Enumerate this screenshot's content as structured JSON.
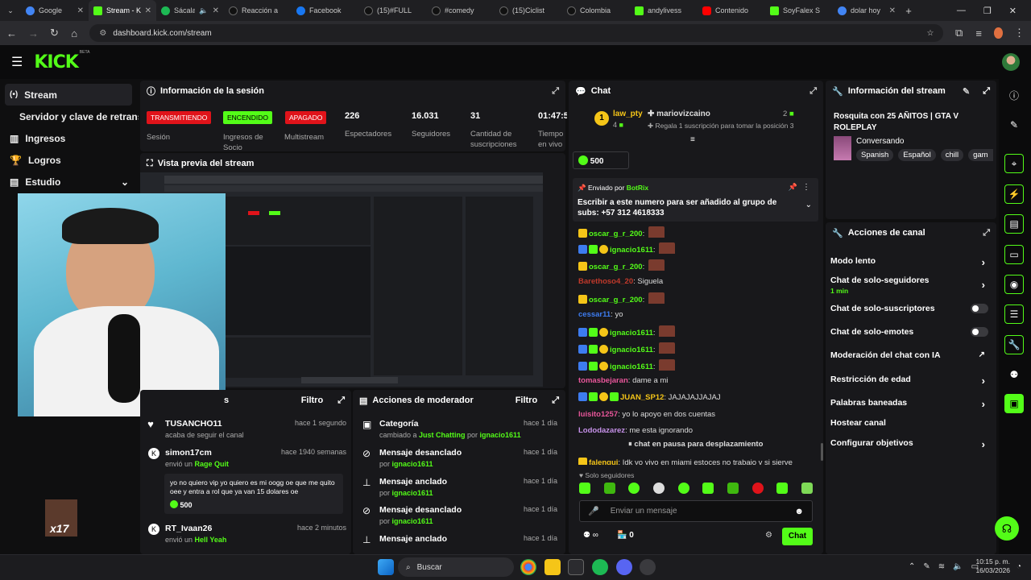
{
  "browser": {
    "tabs": [
      {
        "label": "Google",
        "color": "#4285f4"
      },
      {
        "label": "Stream - K",
        "color": "#53fc18"
      },
      {
        "label": "Sácala",
        "color": "#1db954"
      },
      {
        "label": "Reacción a",
        "color": "#111111"
      },
      {
        "label": "Facebook",
        "color": "#1877f2"
      },
      {
        "label": "(15)#FULL",
        "color": "#111111"
      },
      {
        "label": "#comedy",
        "color": "#111111"
      },
      {
        "label": "(15)Ciclist",
        "color": "#111111"
      },
      {
        "label": "Colombia",
        "color": "#111111"
      },
      {
        "label": "andylivess",
        "color": "#53fc18"
      },
      {
        "label": "Contenido",
        "color": "#ff0000"
      },
      {
        "label": "SoyFalex S",
        "color": "#53fc18"
      },
      {
        "label": "dolar hoy",
        "color": "#4285f4"
      }
    ],
    "url": "dashboard.kick.com/stream"
  },
  "sidebar": {
    "items": [
      {
        "label": "Stream",
        "icon": "stream-icon"
      },
      {
        "label": "Servidor y clave de retransm",
        "icon": ""
      },
      {
        "label": "Ingresos",
        "icon": "revenue-icon"
      },
      {
        "label": "Logros",
        "icon": "trophy-icon"
      },
      {
        "label": "Estudio",
        "icon": "studio-icon"
      }
    ]
  },
  "session": {
    "title": "Información de la sesión",
    "badges": [
      {
        "label": "TRANSMITIENDO",
        "color": "#e0131a",
        "caption": "Sesión"
      },
      {
        "label": "ENCENDIDO",
        "color": "#53fc18",
        "caption": "Ingresos de Socio"
      },
      {
        "label": "APAGADO",
        "color": "#e0131a",
        "caption": "Multistream"
      }
    ],
    "stats": [
      {
        "value": "226",
        "label": "Espectadores"
      },
      {
        "value": "16.031",
        "label": "Seguidores"
      },
      {
        "value": "31",
        "label": "Cantidad de suscripciones"
      },
      {
        "value": "01:47:5",
        "label": "Tiempo en vivo"
      }
    ]
  },
  "preview": {
    "title": "Vista previa del stream"
  },
  "activity": {
    "title_partial": "s",
    "filter": "Filtro",
    "rows": [
      {
        "name": "TUSANCHO11",
        "time": "hace 1 segundo",
        "sub": "acaba de seguir el canal",
        "sub_pre": "",
        "sub_hl": "",
        "sub_post": ""
      },
      {
        "name": "simon17cm",
        "time": "hace 1940 semanas",
        "sub_pre": "envió un ",
        "sub_hl": "Rage Quit",
        "sub_post": ""
      },
      {
        "name": "RT_Ivaan26",
        "time": "hace 2 minutos",
        "sub_pre": "envió un ",
        "sub_hl": "Hell Yeah",
        "sub_post": ""
      }
    ],
    "message": "yo no quiero vip yo quiero es mi oogg oe que me quito oee y entra a rol que ya van 15 dolares oe",
    "amount": "500"
  },
  "mod": {
    "title": "Acciones de moderador",
    "filter": "Filtro",
    "rows": [
      {
        "name": "Categoría",
        "time": "hace 1 día",
        "sub_pre": "cambiado a ",
        "sub_hl": "Just Chatting",
        "sub_mid": " por ",
        "sub_user": "ignacio1611"
      },
      {
        "name": "Mensaje desanclado",
        "time": "hace 1 día",
        "sub_pre": "por ",
        "sub_hl": "",
        "sub_mid": "",
        "sub_user": "ignacio1611"
      },
      {
        "name": "Mensaje anclado",
        "time": "hace 1 día",
        "sub_pre": "por ",
        "sub_hl": "",
        "sub_mid": "",
        "sub_user": "ignacio1611"
      },
      {
        "name": "Mensaje desanclado",
        "time": "hace 1 día",
        "sub_pre": "por ",
        "sub_hl": "",
        "sub_mid": "",
        "sub_user": "ignacio1611"
      },
      {
        "name": "Mensaje anclado",
        "time": "hace 1 día",
        "sub_pre": "",
        "sub_hl": "",
        "sub_mid": "",
        "sub_user": ""
      }
    ]
  },
  "chat": {
    "title": "Chat",
    "leader1": {
      "name": "law_pty",
      "sub": "4"
    },
    "leader2": {
      "name": "mariovizcaino",
      "sub": "Regala 1 suscripción para tomar la posición 3",
      "count": "2"
    },
    "goal": "500",
    "pinned": {
      "by": "Enviado por",
      "user": "BotRix",
      "text": "Escribir a este numero para ser añadido al grupo de subs: +57 312 4618333"
    },
    "messages": [
      {
        "user": "oscar_g_r_200",
        "color": "#53fc18",
        "text": ""
      },
      {
        "user": "ignacio1611",
        "color": "#53fc18",
        "text": ""
      },
      {
        "user": "oscar_g_r_200",
        "color": "#53fc18",
        "text": ""
      },
      {
        "user": "Barethoso4_20",
        "color": "#c0392b",
        "text": "Siguela"
      },
      {
        "user": "oscar_g_r_200",
        "color": "#53fc18",
        "text": ""
      },
      {
        "user": "cessar11",
        "color": "#3d7cf0",
        "text": "yo"
      },
      {
        "user": "ignacio1611",
        "color": "#53fc18",
        "text": ""
      },
      {
        "user": "ignacio1611",
        "color": "#53fc18",
        "text": ""
      },
      {
        "user": "ignacio1611",
        "color": "#53fc18",
        "text": ""
      },
      {
        "user": "tomasbejaran",
        "color": "#e8569a",
        "text": "dame a mi"
      },
      {
        "user": "JUAN_SP12",
        "color": "#f5c518",
        "text": "JAJAJAJJAJAJ"
      },
      {
        "user": "luisito1257",
        "color": "#e8569a",
        "text": "yo lo apoyo en dos cuentas"
      },
      {
        "user": "Lododazarez",
        "color": "#c792ea",
        "text": "me esta ignorando"
      },
      {
        "user": "falenqui",
        "color": "#f5c518",
        "text": "Idk yo vivo en miami estoces no trabajo y si sierve"
      }
    ],
    "paused": "chat en pausa para desplazamiento",
    "followers_only": "Solo seguidores",
    "placeholder": "Enviar un mensaje",
    "points": "0",
    "send": "Chat"
  },
  "stream_info": {
    "title": "Información del stream",
    "stream_title": "Rosquita con 25 AÑITOS | GTA V ROLEPLAY",
    "category": "Conversando",
    "tags": [
      "Spanish",
      "Español",
      "chill",
      "gam"
    ]
  },
  "channel_actions": {
    "title": "Acciones de canal",
    "items": [
      {
        "label": "Modo lento",
        "sub": ""
      },
      {
        "label": "Chat de solo-seguidores",
        "sub": "1 min"
      },
      {
        "label": "Chat de solo-suscriptores",
        "sub": ""
      },
      {
        "label": "Chat de solo-emotes",
        "sub": ""
      },
      {
        "label": "Moderación del chat con IA",
        "sub": ""
      },
      {
        "label": "Restricción de edad",
        "sub": ""
      },
      {
        "label": "Palabras baneadas",
        "sub": ""
      },
      {
        "label": "Hostear canal",
        "sub": ""
      },
      {
        "label": "Configurar objetivos",
        "sub": ""
      }
    ]
  },
  "taskbar": {
    "search": "Buscar",
    "time": "10:15 p. m.",
    "date": "16/03/2026"
  },
  "overlay": {
    "label": "x17"
  }
}
